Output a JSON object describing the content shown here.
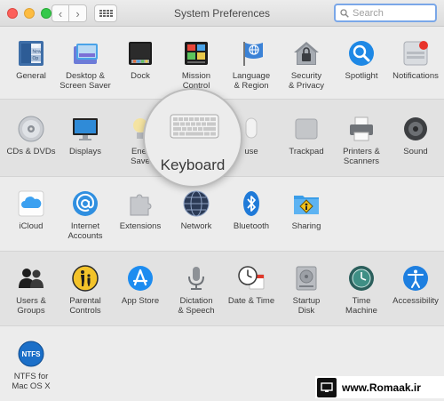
{
  "window": {
    "title": "System Preferences",
    "search_placeholder": "Search",
    "back_glyph": "‹",
    "forward_glyph": "›"
  },
  "rows": [
    [
      {
        "label": "General",
        "icon": "general-icon"
      },
      {
        "label": "Desktop &\nScreen Saver",
        "icon": "desktop-icon"
      },
      {
        "label": "Dock",
        "icon": "dock-icon"
      },
      {
        "label": "Mission\nControl",
        "icon": "mission-control-icon"
      },
      {
        "label": "Language\n& Region",
        "icon": "globe-flag-icon"
      },
      {
        "label": "Security\n& Privacy",
        "icon": "house-lock-icon"
      },
      {
        "label": "Spotlight",
        "icon": "magnifier-icon"
      },
      {
        "label": "Notifications",
        "icon": "notifications-icon"
      }
    ],
    [
      {
        "label": "CDs & DVDs",
        "icon": "disc-icon"
      },
      {
        "label": "Displays",
        "icon": "monitor-icon"
      },
      {
        "label": "Ener\nSave",
        "icon": "bulb-icon"
      },
      {
        "label": "use",
        "icon": "mouse-icon"
      },
      {
        "label": "Trackpad",
        "icon": "trackpad-icon"
      },
      {
        "label": "Printers &\nScanners",
        "icon": "printer-icon"
      },
      {
        "label": "Sound",
        "icon": "speaker-icon"
      }
    ],
    [
      {
        "label": "iCloud",
        "icon": "cloud-icon"
      },
      {
        "label": "Internet\nAccounts",
        "icon": "at-icon"
      },
      {
        "label": "Extensions",
        "icon": "puzzle-icon"
      },
      {
        "label": "Network",
        "icon": "network-globe-icon"
      },
      {
        "label": "Bluetooth",
        "icon": "bluetooth-icon"
      },
      {
        "label": "Sharing",
        "icon": "folder-sign-icon"
      }
    ],
    [
      {
        "label": "Users &\nGroups",
        "icon": "users-icon"
      },
      {
        "label": "Parental\nControls",
        "icon": "parental-icon"
      },
      {
        "label": "App Store",
        "icon": "app-store-icon"
      },
      {
        "label": "Dictation\n& Speech",
        "icon": "microphone-icon"
      },
      {
        "label": "Date & Time",
        "icon": "clock-calendar-icon"
      },
      {
        "label": "Startup\nDisk",
        "icon": "hard-disk-icon"
      },
      {
        "label": "Time\nMachine",
        "icon": "time-machine-icon"
      },
      {
        "label": "Accessibility",
        "icon": "accessibility-icon"
      }
    ],
    [
      {
        "label": "NTFS for\nMac OS X",
        "icon": "ntfs-icon"
      }
    ]
  ],
  "magnifier": {
    "label": "Keyboard",
    "icon": "keyboard-icon"
  },
  "general_icon_text": [
    "File",
    "New",
    "Op"
  ],
  "ntfs_icon_text": "NTFS",
  "watermark": {
    "text": "www.Romaak.ir"
  }
}
